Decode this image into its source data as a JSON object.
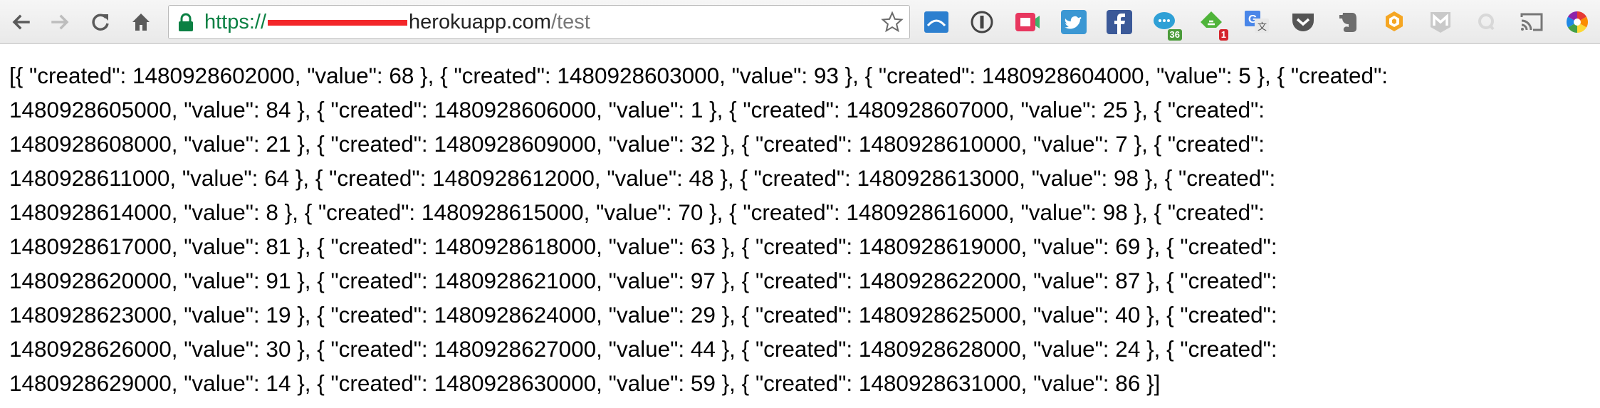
{
  "address_bar": {
    "scheme": "https",
    "slashes": "://",
    "host_visible": "herokuapp.com",
    "path": "/test"
  },
  "toolbar_icons": [
    "back-icon",
    "forward-icon",
    "reload-icon",
    "home-icon",
    "lock-icon",
    "bookmark-star-icon"
  ],
  "extensions": [
    {
      "name": "extension-folder-icon",
      "badge": ""
    },
    {
      "name": "extension-1password-icon",
      "badge": ""
    },
    {
      "name": "extension-camera-icon",
      "badge": ""
    },
    {
      "name": "extension-twitter-icon",
      "badge": ""
    },
    {
      "name": "extension-facebook-icon",
      "badge": "",
      "color": "#3b5998"
    },
    {
      "name": "extension-chat-icon",
      "badge": "36"
    },
    {
      "name": "extension-feedly-icon",
      "badge": "1"
    },
    {
      "name": "extension-google-translate-icon",
      "badge": ""
    },
    {
      "name": "extension-pocket-icon",
      "badge": ""
    },
    {
      "name": "extension-evernote-icon",
      "badge": ""
    },
    {
      "name": "extension-bee-icon",
      "badge": ""
    },
    {
      "name": "extension-mailtrack-icon",
      "badge": ""
    },
    {
      "name": "extension-search-icon",
      "badge": ""
    },
    {
      "name": "extension-cast-icon",
      "badge": ""
    },
    {
      "name": "extension-color-wheel-icon",
      "badge": ""
    }
  ],
  "colors": {
    "secure_green": "#0b8043",
    "redaction": "#f3272a",
    "path_gray": "#777777"
  },
  "body_lines": [
    "[{ \"created\": 1480928602000, \"value\": 68 }, { \"created\": 1480928603000, \"value\": 93 }, { \"created\": 1480928604000, \"value\": 5 }, { \"created\":",
    "1480928605000, \"value\": 84 }, { \"created\": 1480928606000, \"value\": 1 }, { \"created\": 1480928607000, \"value\": 25 }, { \"created\":",
    "1480928608000, \"value\": 21 }, { \"created\": 1480928609000, \"value\": 32 }, { \"created\": 1480928610000, \"value\": 7 }, { \"created\":",
    "1480928611000, \"value\": 64 }, { \"created\": 1480928612000, \"value\": 48 }, { \"created\": 1480928613000, \"value\": 98 }, { \"created\":",
    "1480928614000, \"value\": 8 }, { \"created\": 1480928615000, \"value\": 70 }, { \"created\": 1480928616000, \"value\": 98 }, { \"created\":",
    "1480928617000, \"value\": 81 }, { \"created\": 1480928618000, \"value\": 63 }, { \"created\": 1480928619000, \"value\": 69 }, { \"created\":",
    "1480928620000, \"value\": 91 }, { \"created\": 1480928621000, \"value\": 97 }, { \"created\": 1480928622000, \"value\": 87 }, { \"created\":",
    "1480928623000, \"value\": 19 }, { \"created\": 1480928624000, \"value\": 29 }, { \"created\": 1480928625000, \"value\": 40 }, { \"created\":",
    "1480928626000, \"value\": 30 }, { \"created\": 1480928627000, \"value\": 44 }, { \"created\": 1480928628000, \"value\": 24 }, { \"created\":",
    "1480928629000, \"value\": 14 }, { \"created\": 1480928630000, \"value\": 59 }, { \"created\": 1480928631000, \"value\": 86 }]"
  ]
}
